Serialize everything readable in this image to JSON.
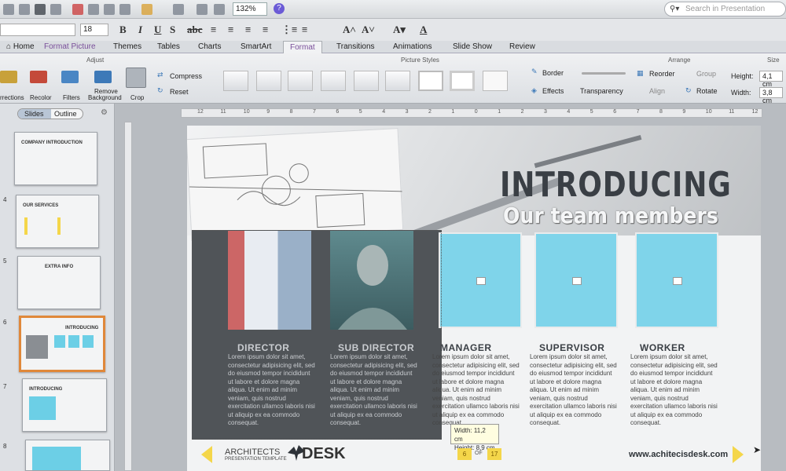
{
  "toolbar": {
    "zoom": "132%",
    "search_placeholder": "Search in Presentation"
  },
  "font": {
    "size": "18"
  },
  "tabs": [
    "Home",
    "Format Picture",
    "Themes",
    "Tables",
    "Charts",
    "SmartArt",
    "Format",
    "Transitions",
    "Animations",
    "Slide Show",
    "Review"
  ],
  "active_tab": "Format",
  "ribbon": {
    "groups": {
      "adjust": "Adjust",
      "picture_styles": "Picture Styles",
      "arrange": "Arrange",
      "size": "Size"
    },
    "buttons": {
      "corrections": "rrections",
      "recolor": "Recolor",
      "filters": "Filters",
      "remove_bg_1": "Remove",
      "remove_bg_2": "Background",
      "crop": "Crop",
      "compress": "Compress",
      "reset": "Reset"
    },
    "format": {
      "border": "Border",
      "effects": "Effects",
      "transparency": "Transparency"
    },
    "arrange": {
      "reorder": "Reorder",
      "group": "Group",
      "align": "Align",
      "rotate": "Rotate"
    },
    "size": {
      "height_label": "Height:",
      "height_value": "4,1 cm",
      "width_label": "Width:",
      "width_value": "3,8 cm"
    }
  },
  "sidebar": {
    "segments": [
      "Slides",
      "Outline"
    ],
    "slides": [
      {
        "num": "",
        "title": "COMPANY INTRODUCTION"
      },
      {
        "num": "4",
        "title": "OUR SERVICES"
      },
      {
        "num": "5",
        "title": "EXTRA INFO"
      },
      {
        "num": "6",
        "title": "INTRODUCING"
      },
      {
        "num": "7",
        "title": "INTRODUCING"
      },
      {
        "num": "8",
        "title": ""
      }
    ]
  },
  "ruler": [
    "12",
    "11",
    "10",
    "9",
    "8",
    "7",
    "6",
    "5",
    "4",
    "3",
    "2",
    "1",
    "0",
    "1",
    "2",
    "3",
    "4",
    "5",
    "6",
    "7",
    "8",
    "9",
    "10",
    "11",
    "12"
  ],
  "slide": {
    "headline": "INTRODUCING",
    "subheadline": "Our team members",
    "members": [
      {
        "role": "DIRECTOR",
        "text": "Lorem ipsum dolor sit amet, consectetur adipisicing elit, sed do eiusmod tempor incididunt ut labore et dolore magna aliqua. Ut enim ad minim veniam, quis nostrud exercitation ullamco laboris nisi ut aliquip ex ea commodo consequat."
      },
      {
        "role": "SUB DIRECTOR",
        "text": "Lorem ipsum dolor sit amet, consectetur adipisicing elit, sed do eiusmod tempor incididunt ut labore et dolore magna aliqua. Ut enim ad minim veniam, quis nostrud exercitation ullamco laboris nisi ut aliquip ex ea commodo consequat."
      },
      {
        "role": "MANAGER",
        "text": "Lorem ipsum dolor sit amet, consectetur adipisicing elit, sed do eiusmod tempor incididunt ut labore et dolore magna aliqua. Ut enim ad minim veniam, quis nostrud exercitation ullamco laboris nisi ut aliquip ex ea commodo consequat."
      },
      {
        "role": "SUPERVISOR",
        "text": "Lorem ipsum dolor sit amet, consectetur adipisicing elit, sed do eiusmod tempor incididunt ut labore et dolore magna aliqua. Ut enim ad minim veniam, quis nostrud exercitation ullamco laboris nisi ut aliquip ex ea commodo consequat."
      },
      {
        "role": "WORKER",
        "text": "Lorem ipsum dolor sit amet, consectetur adipisicing elit, sed do eiusmod tempor incididunt ut labore et dolore magna aliqua. Ut enim ad minim veniam, quis nostrud exercitation ullamco laboris nisi ut aliquip ex ea commodo consequat."
      }
    ],
    "footer": {
      "logo_text": "ARCHITECTS",
      "logo_sub": "PRESENTATION TEMPLATE",
      "desk": "DESK",
      "page": "6",
      "of": "OF",
      "total": "17",
      "url": "www.achitecisdesk.com"
    },
    "size_badge": {
      "width": "Width: 11,2 cm",
      "height": "Height: 8,9 cm"
    }
  },
  "colors": {
    "accent_tab": "#7a4f9a",
    "placeholder_blue": "#7fd4ea",
    "footer_yellow": "#f4d64a",
    "selected_slide": "#e0883a"
  }
}
